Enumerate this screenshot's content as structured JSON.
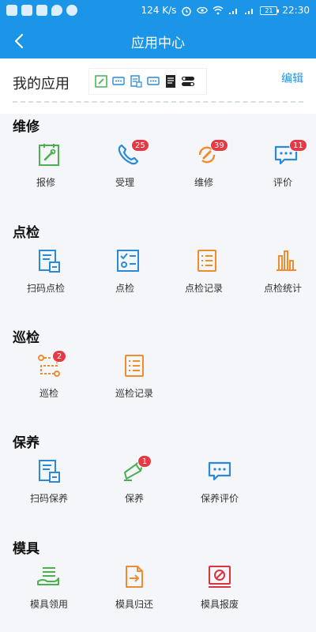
{
  "status_bar": {
    "speed": "124 K/s",
    "battery": "21",
    "time": "22:30",
    "left_icons": [
      "app-icon",
      "app-icon",
      "app-icon",
      "message-icon",
      "app-icon"
    ],
    "right_icons": [
      "alarm-icon",
      "eye-icon",
      "wifi-icon",
      "signal-4g-icon",
      "signal-2g-icon",
      "battery-icon"
    ]
  },
  "header": {
    "title": "应用中心",
    "back_icon": "chevron-left-icon"
  },
  "my_apps": {
    "label": "我的应用",
    "edit": "编辑",
    "shortcut_icons": [
      "wrench-icon",
      "chat-icon",
      "scan-doc-icon",
      "chat-icon",
      "document-icon",
      "toggle-icon"
    ]
  },
  "sections": [
    {
      "title": "维修",
      "items": [
        {
          "label": "报修",
          "icon": "wrench-icon",
          "badge": ""
        },
        {
          "label": "受理",
          "icon": "phone-icon",
          "badge": "25"
        },
        {
          "label": "维修",
          "icon": "repair-icon",
          "badge": "39"
        },
        {
          "label": "评价",
          "icon": "chat-icon",
          "badge": "11"
        }
      ]
    },
    {
      "title": "点检",
      "items": [
        {
          "label": "扫码点检",
          "icon": "scan-doc-icon",
          "badge": ""
        },
        {
          "label": "点检",
          "icon": "checklist-icon",
          "badge": ""
        },
        {
          "label": "点检记录",
          "icon": "list-icon",
          "badge": ""
        },
        {
          "label": "点检统计",
          "icon": "bar-chart-icon",
          "badge": ""
        }
      ]
    },
    {
      "title": "巡检",
      "items": [
        {
          "label": "巡检",
          "icon": "route-icon",
          "badge": "2"
        },
        {
          "label": "巡检记录",
          "icon": "list-icon",
          "badge": ""
        }
      ]
    },
    {
      "title": "保养",
      "items": [
        {
          "label": "扫码保养",
          "icon": "scan-doc-icon",
          "badge": ""
        },
        {
          "label": "保养",
          "icon": "spray-icon",
          "badge": "1"
        },
        {
          "label": "保养评价",
          "icon": "chat-icon",
          "badge": ""
        }
      ]
    },
    {
      "title": "模具",
      "items": [
        {
          "label": "模具领用",
          "icon": "hand-tray-icon",
          "badge": ""
        },
        {
          "label": "模具归还",
          "icon": "return-doc-icon",
          "badge": ""
        },
        {
          "label": "模具报废",
          "icon": "scrap-icon",
          "badge": ""
        }
      ]
    }
  ],
  "colors": {
    "primary": "#1b95e8",
    "badge": "#e53945",
    "green": "#4caf50",
    "orange": "#f08c2d",
    "blue": "#2a8ad8"
  }
}
